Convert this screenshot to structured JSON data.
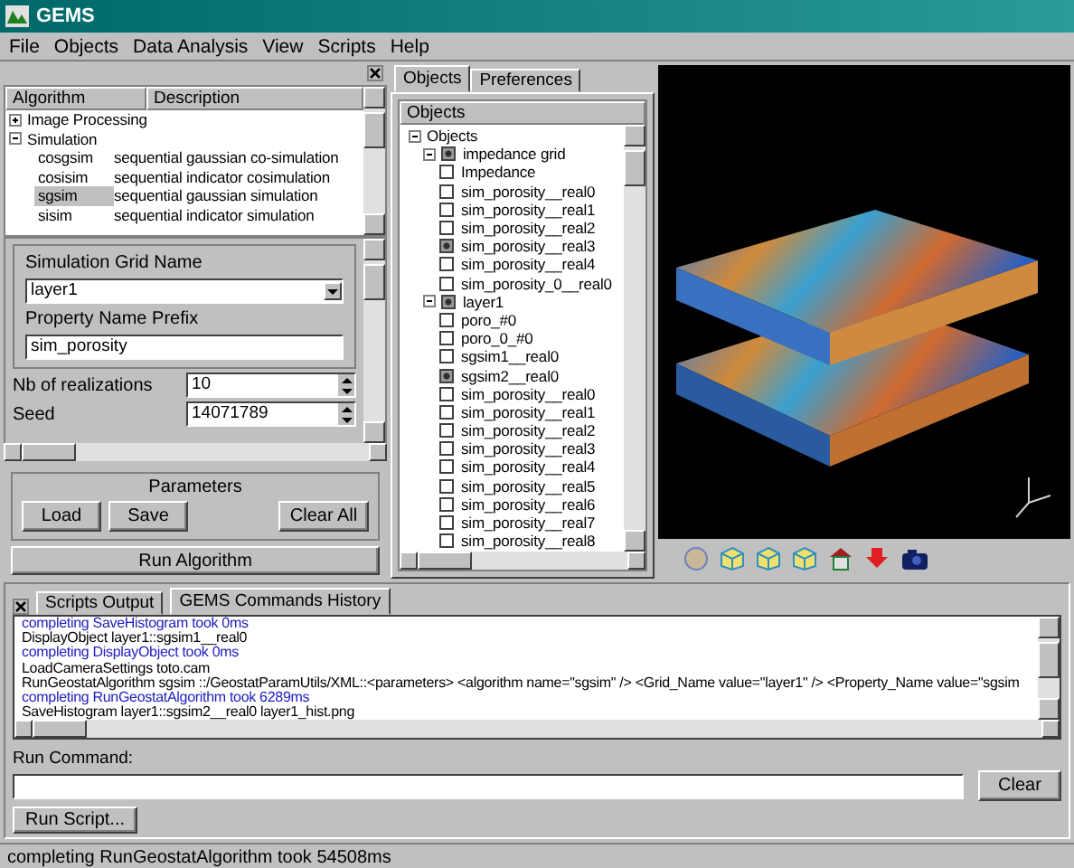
{
  "window": {
    "title": "GEMS"
  },
  "menu": [
    "File",
    "Objects",
    "Data Analysis",
    "View",
    "Scripts",
    "Help"
  ],
  "algorithms": {
    "columns": [
      "Algorithm",
      "Description"
    ],
    "tree": [
      {
        "label": "Image Processing",
        "expanded": false
      },
      {
        "label": "Simulation",
        "expanded": true,
        "children": [
          {
            "name": "cosgsim",
            "description": "sequential gaussian co-simulation",
            "selected": false
          },
          {
            "name": "cosisim",
            "description": "sequential indicator cosimulation",
            "selected": false
          },
          {
            "name": "sgsim",
            "description": "sequential gaussian simulation",
            "selected": true
          },
          {
            "name": "sisim",
            "description": "sequential indicator simulation",
            "selected": false
          }
        ]
      }
    ]
  },
  "parameters_form": {
    "grid_label": "Simulation Grid Name",
    "grid_value": "layer1",
    "prefix_label": "Property Name Prefix",
    "prefix_value": "sim_porosity",
    "realizations_label": "Nb of realizations",
    "realizations_value": "10",
    "seed_label": "Seed",
    "seed_value": "14071789"
  },
  "parameters_group": {
    "title": "Parameters",
    "buttons": [
      "Load",
      "Save",
      "Clear All"
    ]
  },
  "run_button": "Run Algorithm",
  "objects": {
    "tabs": [
      {
        "label": "Objects",
        "selected": true
      },
      {
        "label": "Preferences",
        "selected": false
      }
    ],
    "header": "Objects",
    "root": "Objects",
    "groups": [
      {
        "label": "impedance grid",
        "checked": true,
        "children": [
          {
            "label": "Impedance",
            "checked": false
          },
          {
            "label": "sim_porosity__real0",
            "checked": false
          },
          {
            "label": "sim_porosity__real1",
            "checked": false
          },
          {
            "label": "sim_porosity__real2",
            "checked": false
          },
          {
            "label": "sim_porosity__real3",
            "checked": true
          },
          {
            "label": "sim_porosity__real4",
            "checked": false
          },
          {
            "label": "sim_porosity_0__real0",
            "checked": false
          }
        ]
      },
      {
        "label": "layer1",
        "checked": true,
        "children": [
          {
            "label": "poro_#0",
            "checked": false
          },
          {
            "label": "poro_0_#0",
            "checked": false
          },
          {
            "label": "sgsim1__real0",
            "checked": false
          },
          {
            "label": "sgsim2__real0",
            "checked": true
          },
          {
            "label": "sim_porosity__real0",
            "checked": false
          },
          {
            "label": "sim_porosity__real1",
            "checked": false
          },
          {
            "label": "sim_porosity__real2",
            "checked": false
          },
          {
            "label": "sim_porosity__real3",
            "checked": false
          },
          {
            "label": "sim_porosity__real4",
            "checked": false
          },
          {
            "label": "sim_porosity__real5",
            "checked": false
          },
          {
            "label": "sim_porosity__real6",
            "checked": false
          },
          {
            "label": "sim_porosity__real7",
            "checked": false
          },
          {
            "label": "sim_porosity__real8",
            "checked": false
          }
        ]
      }
    ]
  },
  "console": {
    "tabs": [
      {
        "label": "Scripts Output",
        "selected": false
      },
      {
        "label": "GEMS Commands History",
        "selected": true
      }
    ],
    "lines": [
      {
        "kind": "completion",
        "text": "completing SaveHistogram took 0ms"
      },
      {
        "kind": "command",
        "text": "DisplayObject layer1::sgsim1__real0"
      },
      {
        "kind": "completion",
        "text": "completing DisplayObject took 0ms"
      },
      {
        "kind": "command",
        "text": "LoadCameraSettings toto.cam"
      },
      {
        "kind": "command",
        "text": "RunGeostatAlgorithm sgsim ::/GeostatParamUtils/XML::<parameters> <algorithm name=\"sgsim\" /> <Grid_Name value=\"layer1\" /> <Property_Name value=\"sgsim"
      },
      {
        "kind": "completion",
        "text": "completing RunGeostatAlgorithm took 6289ms"
      },
      {
        "kind": "command",
        "text": "SaveHistogram layer1::sgsim2__real0 layer1_hist.png"
      }
    ]
  },
  "run_command": {
    "label": "Run Command:",
    "clear_button": "Clear",
    "run_script_button": "Run Script..."
  },
  "status_bar": "completing RunGeostatAlgorithm took 54508ms"
}
